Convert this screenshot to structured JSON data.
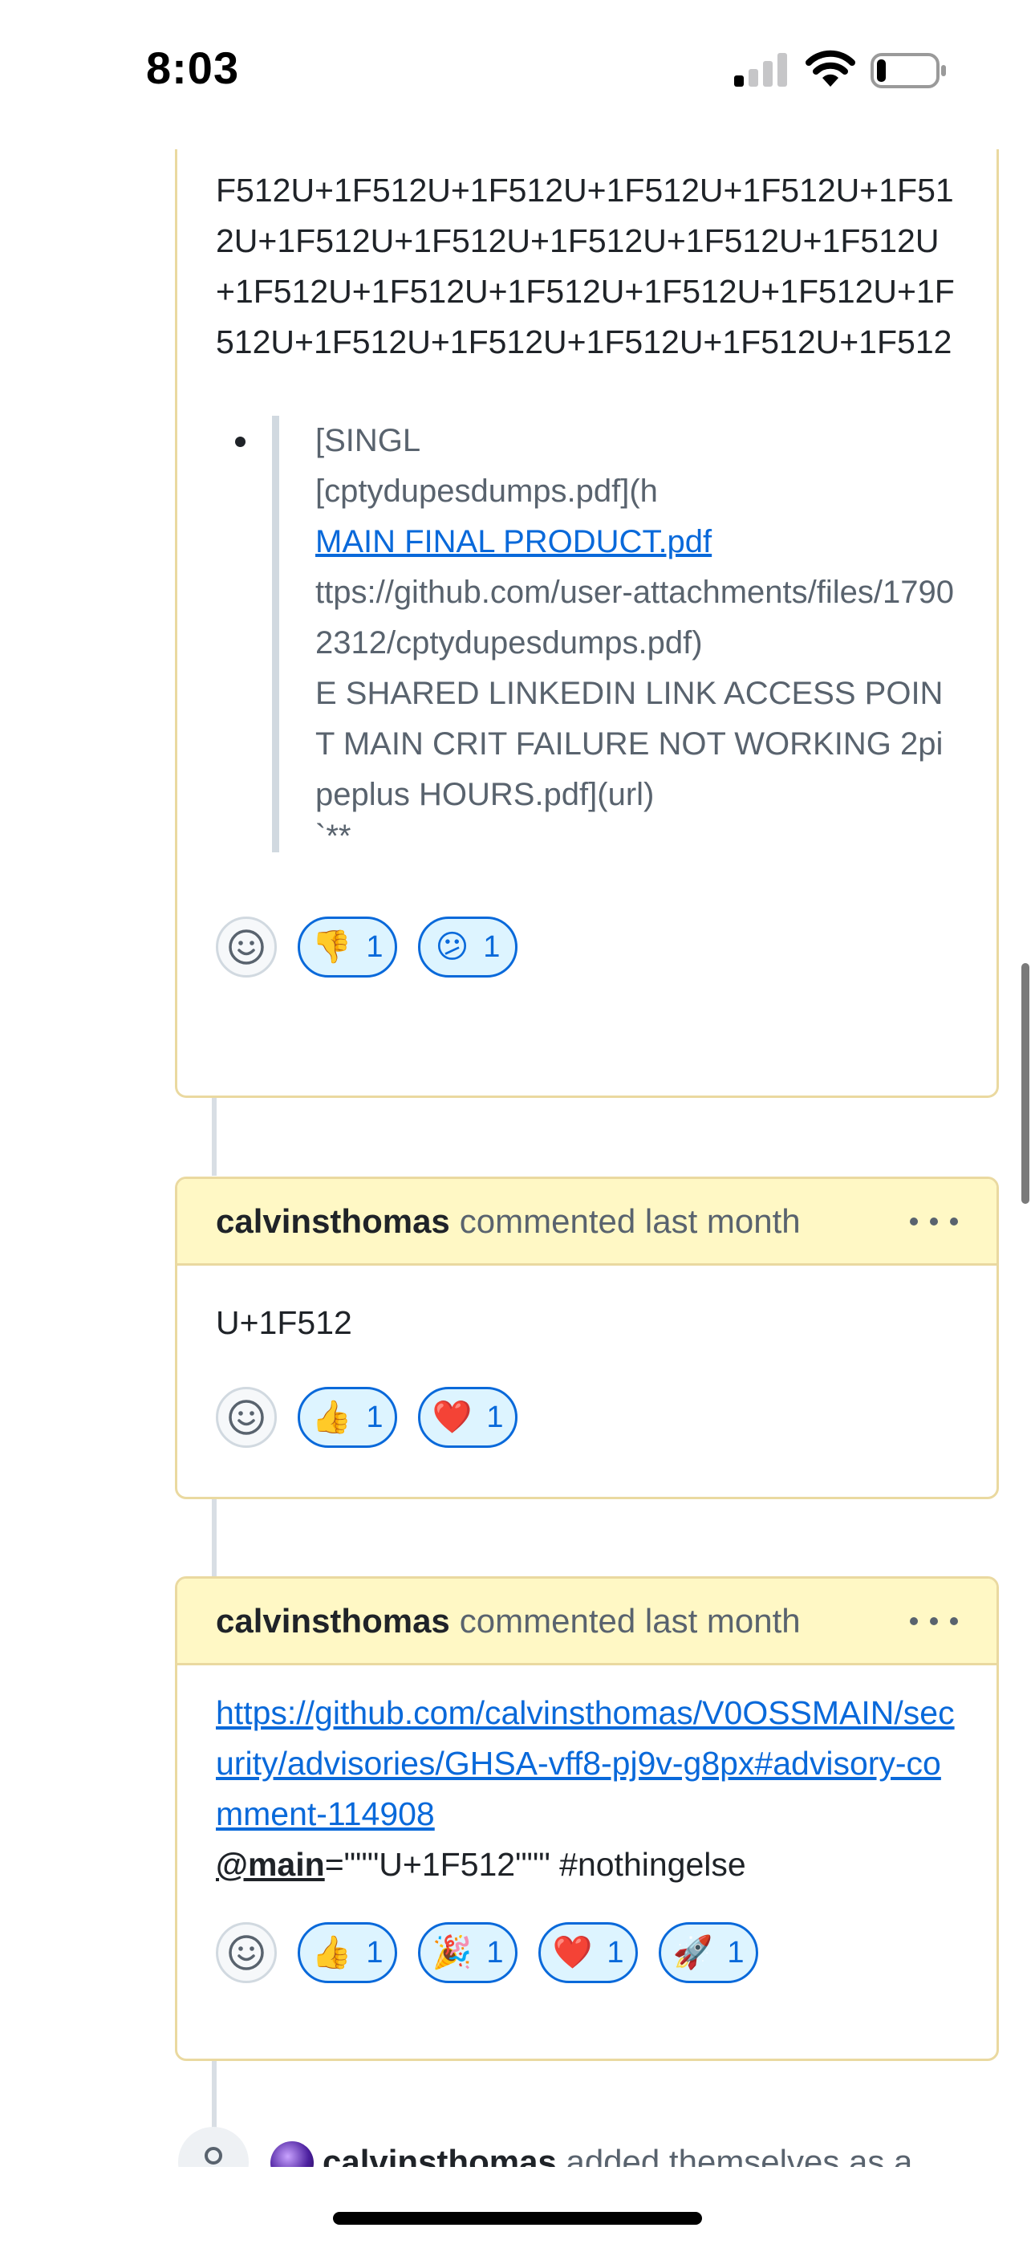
{
  "status_bar": {
    "time": "8:03",
    "signal_bars_active": 1,
    "battery_level": 0.15
  },
  "comment_top": {
    "body_text": "F512U+1F512U+1F512U+1F512U+1F512U+1F512U+1F512U+1F512U+1F512U+1F512U+1F512U+1F512U+1F512U+1F512U+1F512U+1F512U+1F512U+1F512U+1F512U+1F512U+1F512U+1F512",
    "quote": {
      "line1": "[SINGL",
      "line2": "[cptydupesdumps.pdf](h",
      "link": "MAIN FINAL PRODUCT.pdf",
      "line3": "ttps://github.com/user-attachments/files/17902312/cptydupesdumps.pdf)",
      "line4": "E SHARED LINKEDIN LINK ACCESS POINT MAIN CRIT FAILURE NOT WORKING 2pipeplus HOURS.pdf](url)",
      "line5": "`**"
    },
    "reactions": [
      {
        "emoji": "👎",
        "count": "1",
        "icon": "thumbs-down"
      },
      {
        "emoji": "😕",
        "count": "1",
        "icon": "confused-face"
      }
    ]
  },
  "comment_2": {
    "author": "calvinsthomas",
    "meta": "commented last month",
    "body": "U+1F512",
    "reactions": [
      {
        "emoji": "👍",
        "count": "1",
        "icon": "thumbs-up"
      },
      {
        "emoji": "❤️",
        "count": "1",
        "icon": "heart"
      }
    ]
  },
  "comment_3": {
    "author": "calvinsthomas",
    "meta": "commented last month",
    "link": "https://github.com/calvinsthomas/V0OSSMAIN/security/advisories/GHSA-vff8-pj9v-g8px#advisory-comment-114908",
    "mention": "@main",
    "body_rest": "=\"\"\"U+1F512\"\"\" #nothingelse",
    "reactions": [
      {
        "emoji": "👍",
        "count": "1",
        "icon": "thumbs-up"
      },
      {
        "emoji": "🎉",
        "count": "1",
        "icon": "party-popper"
      },
      {
        "emoji": "❤️",
        "count": "1",
        "icon": "heart"
      },
      {
        "emoji": "🚀",
        "count": "1",
        "icon": "rocket"
      }
    ]
  },
  "event": {
    "author": "calvinsthomas",
    "text": "added themselves as a"
  },
  "colors": {
    "link": "#0969da",
    "header_bg": "#fff8c5",
    "card_border": "#ead9a0",
    "reaction_bg": "#ddf4ff"
  }
}
